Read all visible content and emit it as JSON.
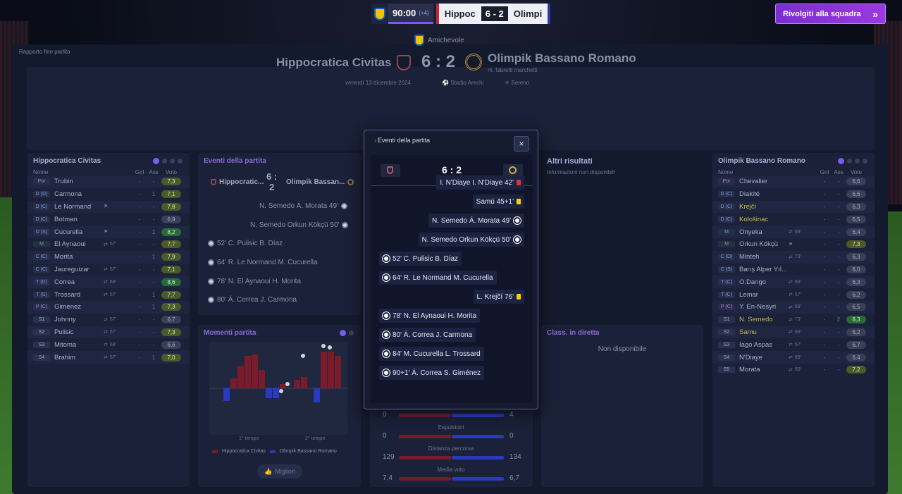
{
  "topbar": {
    "clock": "90:00",
    "extra_time": "(+4)",
    "home_short": "Hippoc",
    "score": "6 - 2",
    "away_short": "Olimpi",
    "back_button": "Rivolgiti alla squadra"
  },
  "report_label": "Rapporto fine partita",
  "match": {
    "competition": "Amichevole",
    "home_name": "Hippocratica Civitas",
    "score": "6 : 2",
    "away_name": "Olimpik Bassano Romano",
    "away_manager": "m. fabretti marchetti",
    "date": "venerdì 13 dicembre 2024",
    "stadium": "Stadio Arechi",
    "weather": "Sereno"
  },
  "home_panel": {
    "title": "Hippocratica Civitas",
    "headers": {
      "name": "Nome",
      "goals": "Gol",
      "assists": "Ass",
      "rating": "Voto"
    },
    "players": [
      {
        "pos": "Por",
        "name": "Trubin",
        "misc": "",
        "gol": "-",
        "ass": "-",
        "rating": "7,3"
      },
      {
        "pos": "D (D)",
        "name": "Carmona",
        "misc": "",
        "gol": "-",
        "ass": "1",
        "rating": "7,1"
      },
      {
        "pos": "D (C)",
        "name": "Le Normand",
        "misc": "boot",
        "gol": "-",
        "ass": "-",
        "rating": "7,8"
      },
      {
        "pos": "D (C)",
        "name": "Botman",
        "misc": "",
        "gol": "-",
        "ass": "-",
        "rating": "6,9"
      },
      {
        "pos": "D (S)",
        "name": "Cucurella",
        "misc": "boot",
        "gol": "-",
        "ass": "1",
        "rating": "8,2"
      },
      {
        "pos": "M",
        "name": "El Aynaoui",
        "misc": "57'",
        "gol": "-",
        "ass": "-",
        "rating": "7,7"
      },
      {
        "pos": "C (C)",
        "name": "Morita",
        "misc": "",
        "gol": "-",
        "ass": "1",
        "rating": "7,9"
      },
      {
        "pos": "C (C)",
        "name": "Jaureguizar",
        "misc": "57'",
        "gol": "-",
        "ass": "-",
        "rating": "7,1"
      },
      {
        "pos": "T (D)",
        "name": "Correa",
        "misc": "69'",
        "gol": "-",
        "ass": "-",
        "rating": "8,6"
      },
      {
        "pos": "T (S)",
        "name": "Trossard",
        "misc": "57'",
        "gol": "-",
        "ass": "1",
        "rating": "7,7"
      },
      {
        "pos": "P (C)",
        "name": "Gimenez",
        "misc": "",
        "gol": "-",
        "ass": "1",
        "rating": "7,3"
      },
      {
        "pos": "S1",
        "name": "Johnny",
        "misc": "57'",
        "gol": "-",
        "ass": "-",
        "rating": "6,7"
      },
      {
        "pos": "S2",
        "name": "Pulisic",
        "misc": "57'",
        "gol": "-",
        "ass": "-",
        "rating": "7,3"
      },
      {
        "pos": "S3",
        "name": "Mitoma",
        "misc": "69'",
        "gol": "-",
        "ass": "-",
        "rating": "6,6"
      },
      {
        "pos": "S4",
        "name": "Brahim",
        "misc": "57'",
        "gol": "-",
        "ass": "1",
        "rating": "7,0"
      }
    ]
  },
  "away_panel": {
    "title": "Olimpik Bassano Romano",
    "headers": {
      "name": "Nome",
      "goals": "Gol",
      "assists": "Ass",
      "rating": "Voto"
    },
    "players": [
      {
        "pos": "Por",
        "name": "Chevalier",
        "misc": "",
        "gol": "-",
        "ass": "-",
        "rating": "6,6"
      },
      {
        "pos": "D (C)",
        "name": "Diakité",
        "misc": "",
        "gol": "-",
        "ass": "-",
        "rating": "6,6"
      },
      {
        "pos": "D (C)",
        "name": "Krejčí",
        "misc": "",
        "gol": "-",
        "ass": "-",
        "rating": "6,3"
      },
      {
        "pos": "D (C)",
        "name": "Kološinac",
        "misc": "",
        "gol": "-",
        "ass": "-",
        "rating": "6,5"
      },
      {
        "pos": "M",
        "name": "Onyeka",
        "misc": "69'",
        "gol": "-",
        "ass": "-",
        "rating": "6,4"
      },
      {
        "pos": "M",
        "name": "Orkun Kökçü",
        "misc": "boot",
        "gol": "-",
        "ass": "-",
        "rating": "7,3"
      },
      {
        "pos": "C (D)",
        "name": "Minteh",
        "misc": "73'",
        "gol": "-",
        "ass": "-",
        "rating": "6,3"
      },
      {
        "pos": "C (S)",
        "name": "Barış Alper Yıl...",
        "misc": "",
        "gol": "-",
        "ass": "-",
        "rating": "6,0"
      },
      {
        "pos": "T (C)",
        "name": "O.Dango",
        "misc": "69'",
        "gol": "-",
        "ass": "-",
        "rating": "6,3"
      },
      {
        "pos": "T (C)",
        "name": "Lemar",
        "misc": "57'",
        "gol": "-",
        "ass": "-",
        "rating": "6,2"
      },
      {
        "pos": "P (C)",
        "name": "Y. En-Nesyri",
        "misc": "69'",
        "gol": "-",
        "ass": "-",
        "rating": "6,5"
      },
      {
        "pos": "S1",
        "name": "N. Semedo",
        "misc": "73'",
        "gol": "-",
        "ass": "2",
        "rating": "8,3"
      },
      {
        "pos": "S2",
        "name": "Samu",
        "misc": "69'",
        "gol": "-",
        "ass": "-",
        "rating": "6,2"
      },
      {
        "pos": "S3",
        "name": "Iago Aspas",
        "misc": "57'",
        "gol": "-",
        "ass": "-",
        "rating": "6,7"
      },
      {
        "pos": "S4",
        "name": "N'Diaye",
        "misc": "69'",
        "gol": "-",
        "ass": "-",
        "rating": "6,4"
      },
      {
        "pos": "S5",
        "name": "Morata",
        "misc": "69'",
        "gol": "-",
        "ass": "-",
        "rating": "7,2"
      }
    ]
  },
  "events_panel": {
    "title": "Eventi della partita",
    "home_short": "Hippocratic...",
    "score_line1": "6 :",
    "score_line2": "2",
    "away_short": "Olimpik Bassan...",
    "rows": [
      "N. Semedo Á. Morata 49'",
      "N. Semedo Orkun Kökçü 50'",
      "52' C. Pulisic B. Díaz",
      "64' R. Le Normand M. Cucurella",
      "78' N. El Aynaoui H. Morita",
      "80' Á. Correa J. Carmona"
    ]
  },
  "others": {
    "title": "Altri risultati",
    "empty": "Informazioni non disponibili"
  },
  "moments": {
    "title": "Momenti partita",
    "first_half": "1° tempo",
    "second_half": "2° tempo",
    "legend_home": "Hippocratica Civitas",
    "legend_away": "Olimpik Bassano Romano",
    "best_button": "Migliori",
    "home_color": "#7a1a2a",
    "away_color": "#2a3ac0"
  },
  "live_table": {
    "title": "Class. in diretta",
    "empty": "Non disponibile"
  },
  "stats": {
    "rows": [
      {
        "label": "",
        "home": "0",
        "away": "4"
      },
      {
        "label": "Espulsioni",
        "home": "0",
        "away": "0"
      },
      {
        "label": "Distanza percorsa",
        "home": "129",
        "away": "134"
      },
      {
        "label": "Media voto",
        "home": "7,4",
        "away": "6,7"
      }
    ]
  },
  "modal": {
    "title": "Eventi della partita",
    "close_label": "×",
    "score": "6 : 2",
    "events": [
      {
        "text": "I. N'Diaye I. N'Diaye 42'",
        "side": "away",
        "icon": "red-card"
      },
      {
        "text": "Samú 45+1'",
        "side": "away",
        "icon": "yellow-card"
      },
      {
        "text": "N. Semedo Á. Morata 49'",
        "side": "away",
        "icon": "goal"
      },
      {
        "text": "N. Semedo Orkun Kökçü 50'",
        "side": "away",
        "icon": "goal"
      },
      {
        "text": "52' C. Pulisic B. Díaz",
        "side": "home",
        "icon": "goal"
      },
      {
        "text": "64' R. Le Normand M. Cucurella",
        "side": "home",
        "icon": "goal"
      },
      {
        "text": "L. Krejčí 76'",
        "side": "away",
        "icon": "yellow-card"
      },
      {
        "text": "78' N. El Aynaoui H. Morita",
        "side": "home",
        "icon": "goal"
      },
      {
        "text": "80' Á. Correa J. Carmona",
        "side": "home",
        "icon": "goal"
      },
      {
        "text": "84' M. Cucurella L. Trossard",
        "side": "home",
        "icon": "goal"
      },
      {
        "text": "90+1' Á. Correa S. Giménez",
        "side": "home",
        "icon": "goal"
      }
    ]
  }
}
